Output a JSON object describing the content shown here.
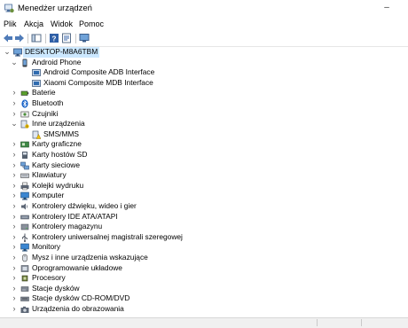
{
  "window": {
    "title": "Menedżer urządzeń",
    "minimize_label": "–"
  },
  "menu": [
    "Plik",
    "Akcja",
    "Widok",
    "Pomoc"
  ],
  "toolbar": [
    "back-icon",
    "forward-icon",
    "show-hide-console-tree-icon",
    "help-icon",
    "properties-icon",
    "monitor-icon"
  ],
  "tree": [
    {
      "level": 0,
      "exp": "open",
      "icon": "computer",
      "label": "DESKTOP-M8A6TBM",
      "selected": true
    },
    {
      "level": 1,
      "exp": "open",
      "icon": "phone",
      "label": "Android Phone"
    },
    {
      "level": 2,
      "exp": "none",
      "icon": "device",
      "label": "Android Composite ADB Interface"
    },
    {
      "level": 2,
      "exp": "none",
      "icon": "device",
      "label": "Xiaomi Composite MDB Interface"
    },
    {
      "level": 1,
      "exp": "closed",
      "icon": "battery",
      "label": "Baterie"
    },
    {
      "level": 1,
      "exp": "closed",
      "icon": "bluetooth",
      "label": "Bluetooth"
    },
    {
      "level": 1,
      "exp": "closed",
      "icon": "sensor",
      "label": "Czujniki"
    },
    {
      "level": 1,
      "exp": "open",
      "icon": "other",
      "label": "Inne urządzenia"
    },
    {
      "level": 2,
      "exp": "none",
      "icon": "warning-device",
      "label": "SMS/MMS"
    },
    {
      "level": 1,
      "exp": "closed",
      "icon": "display",
      "label": "Karty graficzne"
    },
    {
      "level": 1,
      "exp": "closed",
      "icon": "sd",
      "label": "Karty hostów SD"
    },
    {
      "level": 1,
      "exp": "closed",
      "icon": "network",
      "label": "Karty sieciowe"
    },
    {
      "level": 1,
      "exp": "closed",
      "icon": "keyboard",
      "label": "Klawiatury"
    },
    {
      "level": 1,
      "exp": "closed",
      "icon": "printer",
      "label": "Kolejki wydruku"
    },
    {
      "level": 1,
      "exp": "closed",
      "icon": "monitor",
      "label": "Komputer"
    },
    {
      "level": 1,
      "exp": "closed",
      "icon": "sound",
      "label": "Kontrolery dźwięku, wideo i gier"
    },
    {
      "level": 1,
      "exp": "closed",
      "icon": "ide",
      "label": "Kontrolery IDE ATA/ATAPI"
    },
    {
      "level": 1,
      "exp": "closed",
      "icon": "storage",
      "label": "Kontrolery magazynu"
    },
    {
      "level": 1,
      "exp": "closed",
      "icon": "usb",
      "label": "Kontrolery uniwersalnej magistrali szeregowej"
    },
    {
      "level": 1,
      "exp": "closed",
      "icon": "monitor",
      "label": "Monitory"
    },
    {
      "level": 1,
      "exp": "closed",
      "icon": "mouse",
      "label": "Mysz i inne urządzenia wskazujące"
    },
    {
      "level": 1,
      "exp": "closed",
      "icon": "firmware",
      "label": "Oprogramowanie układowe"
    },
    {
      "level": 1,
      "exp": "closed",
      "icon": "cpu",
      "label": "Procesory"
    },
    {
      "level": 1,
      "exp": "closed",
      "icon": "disk",
      "label": "Stacje dysków"
    },
    {
      "level": 1,
      "exp": "closed",
      "icon": "dvd",
      "label": "Stacje dysków CD-ROM/DVD"
    },
    {
      "level": 1,
      "exp": "closed",
      "icon": "camera",
      "label": "Urządzenia do obrazowania"
    }
  ]
}
